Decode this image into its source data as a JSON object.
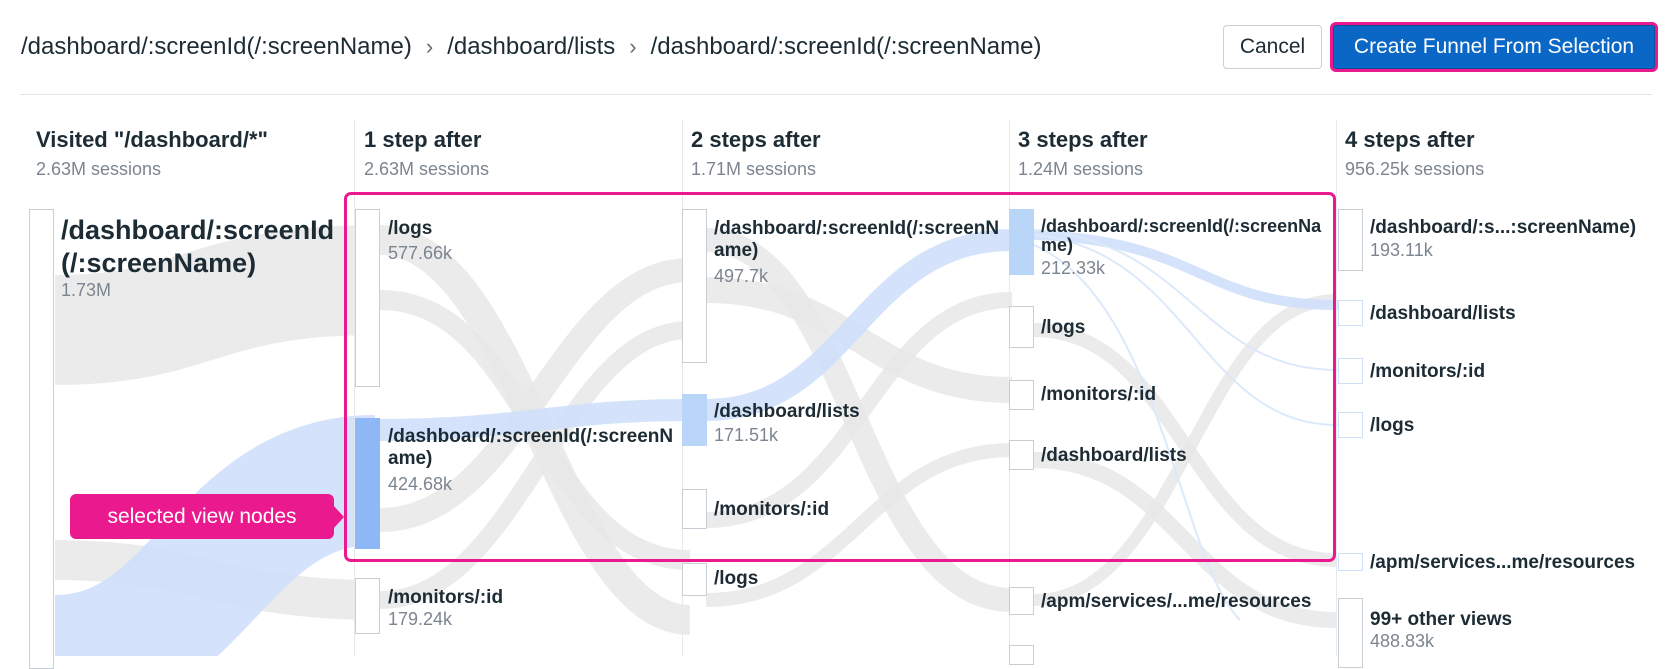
{
  "breadcrumb": [
    "/dashboard/:screenId(/:screenName)",
    "/dashboard/lists",
    "/dashboard/:screenId(/:screenName)"
  ],
  "buttons": {
    "cancel": "Cancel",
    "create": "Create Funnel From Selection"
  },
  "columns": [
    {
      "title": "Visited \"/dashboard/*\"",
      "sessions": "2.63M sessions"
    },
    {
      "title": "1 step after",
      "sessions": "2.63M sessions"
    },
    {
      "title": "2 steps after",
      "sessions": "1.71M sessions"
    },
    {
      "title": "3 steps after",
      "sessions": "1.24M sessions"
    },
    {
      "title": "4 steps after",
      "sessions": "956.25k sessions"
    }
  ],
  "col0": {
    "name": "/dashboard/:screenId(/:screenName)",
    "value": "1.73M"
  },
  "col1": [
    {
      "name": "/logs",
      "value": "577.66k"
    },
    {
      "name": "/dashboard/:screenId(/:screenName)",
      "value": "424.68k"
    },
    {
      "name": "/monitors/:id",
      "value": "179.24k"
    }
  ],
  "col2": [
    {
      "name": "/dashboard/:screenId(/:screenName)",
      "value": "497.7k"
    },
    {
      "name": "/dashboard/lists",
      "value": "171.51k"
    },
    {
      "name": "/monitors/:id",
      "value": ""
    },
    {
      "name": "/logs",
      "value": ""
    }
  ],
  "col3": [
    {
      "name": "/dashboard/:screenId(/:screenName)",
      "value": "212.33k"
    },
    {
      "name": "/logs",
      "value": ""
    },
    {
      "name": "/monitors/:id",
      "value": ""
    },
    {
      "name": "/dashboard/lists",
      "value": ""
    },
    {
      "name": "/apm/services/...me/resources",
      "value": ""
    }
  ],
  "col4": [
    {
      "name": "/dashboard/:s...:screenName)",
      "value": "193.11k"
    },
    {
      "name": "/dashboard/lists",
      "value": ""
    },
    {
      "name": "/monitors/:id",
      "value": ""
    },
    {
      "name": "/logs",
      "value": ""
    },
    {
      "name": "/apm/services...me/resources",
      "value": ""
    },
    {
      "name": "99+ other views",
      "value": "488.83k"
    }
  ],
  "callout": "selected view nodes",
  "colors": {
    "selection": "#ea1a8e",
    "primary": "#0b67c6",
    "selected_node": "#8eb8f5",
    "flow_selected": "#cfe0fb",
    "flow_other": "#e9e9e9"
  }
}
